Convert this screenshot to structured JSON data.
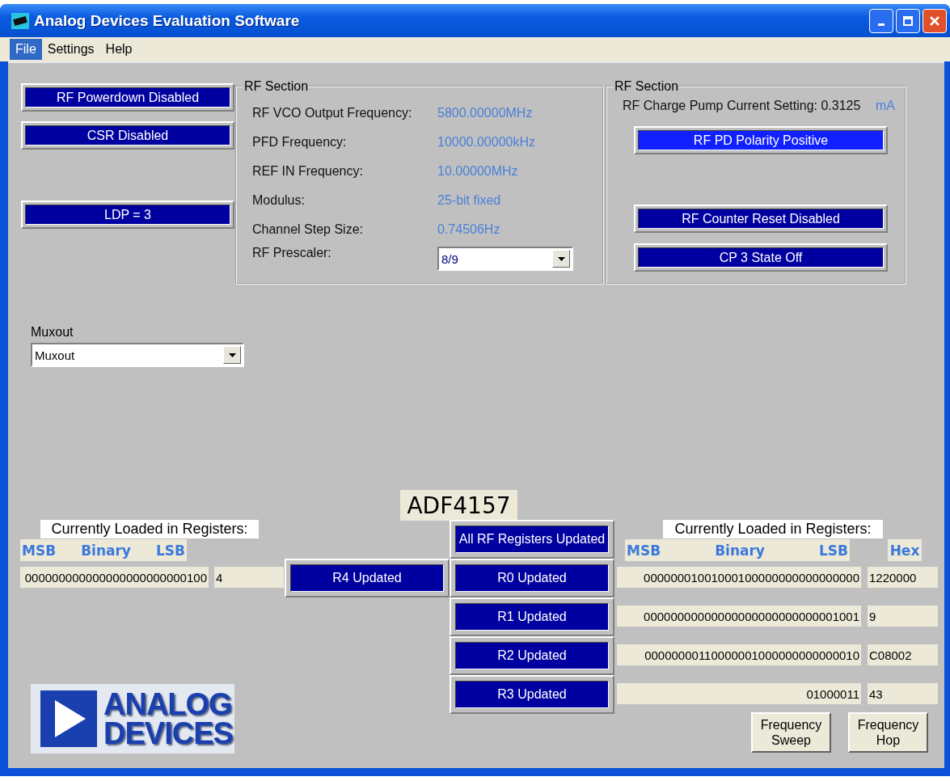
{
  "window": {
    "title": "Analog Devices Evaluation Software"
  },
  "menu": [
    {
      "label": "File",
      "selected": true
    },
    {
      "label": "Settings",
      "selected": false
    },
    {
      "label": "Help",
      "selected": false
    }
  ],
  "left_buttons": [
    {
      "label": "RF Powerdown Disabled",
      "highlighted": false
    },
    {
      "label": "CSR Disabled",
      "highlighted": false
    },
    {
      "label": "LDP = 3",
      "highlighted": false
    }
  ],
  "rf_section_1": {
    "title": "RF Section",
    "rows": [
      {
        "label": "RF VCO Output Frequency:",
        "value": "5800.00000MHz"
      },
      {
        "label": "PFD Frequency:",
        "value": "10000.00000kHz"
      },
      {
        "label": "REF IN Frequency:",
        "value": "10.00000MHz"
      },
      {
        "label": "Modulus:",
        "value": "25-bit fixed"
      },
      {
        "label": "Channel Step Size:",
        "value": "0.74506Hz"
      }
    ],
    "prescaler": {
      "label": "RF Prescaler:",
      "value": "8/9"
    }
  },
  "rf_section_2": {
    "title": "RF Section",
    "charge_pump": "RF Charge Pump Current Setting: 0.3125",
    "unit": "mA",
    "buttons": [
      {
        "label": "RF PD Polarity Positive",
        "highlighted": true
      },
      {
        "label": "RF Counter Reset Disabled",
        "highlighted": false
      },
      {
        "label": "CP 3 State Off",
        "highlighted": false
      }
    ]
  },
  "muxout": {
    "label": "Muxout",
    "value": "Muxout"
  },
  "device_name": "ADF4157",
  "left_registers": {
    "title": "Currently Loaded in Registers:",
    "headers": [
      "MSB",
      "Binary",
      "LSB"
    ],
    "rows": [
      {
        "binary": "000000000000000000000000100",
        "hex": "4"
      }
    ]
  },
  "r4_button": {
    "label": "R4 Updated",
    "highlighted": false
  },
  "register_buttons": [
    {
      "label": "All RF Registers Updated",
      "highlighted": false
    },
    {
      "label": "R0 Updated",
      "highlighted": false
    },
    {
      "label": "R1 Updated",
      "highlighted": false
    },
    {
      "label": "R2 Updated",
      "highlighted": false
    },
    {
      "label": "R3 Updated",
      "highlighted": false
    }
  ],
  "right_registers": {
    "title": "Currently Loaded in Registers:",
    "headers": [
      "MSB",
      "Binary",
      "LSB"
    ],
    "hex_header": "Hex",
    "rows": [
      {
        "binary": "00000001001000100000000000000000",
        "hex": "1220000"
      },
      {
        "binary": "00000000000000000000000000001001",
        "hex": "9"
      },
      {
        "binary": "00000000110000001000000000000010",
        "hex": "C08002"
      },
      {
        "binary": "01000011",
        "hex": "43"
      }
    ]
  },
  "action_buttons": [
    "Frequency Sweep",
    "Frequency Hop"
  ],
  "logo": {
    "lines": [
      "ANALOG",
      "DEVICES"
    ]
  }
}
